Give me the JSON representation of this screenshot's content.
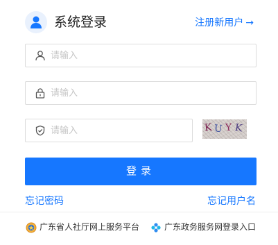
{
  "header": {
    "title": "系统登录",
    "register_label": "注册新用户",
    "register_arrow": "→"
  },
  "form": {
    "username": {
      "placeholder": "请输入",
      "value": ""
    },
    "password": {
      "placeholder": "请输入",
      "value": ""
    },
    "captcha_input": {
      "placeholder": "请输入",
      "value": ""
    },
    "captcha_chars": [
      "K",
      "U",
      "Y",
      "K"
    ],
    "login_label": "登录"
  },
  "links": {
    "forgot_password": "忘记密码",
    "forgot_username": "忘记用户名"
  },
  "footer": {
    "hrss_platform": "广东省人社厅网上服务平台",
    "gov_service": "广东政务服务网登录入口"
  },
  "colors": {
    "accent": "#1677ff",
    "border": "#dcdcdc",
    "placeholder": "#c6c6c6"
  }
}
